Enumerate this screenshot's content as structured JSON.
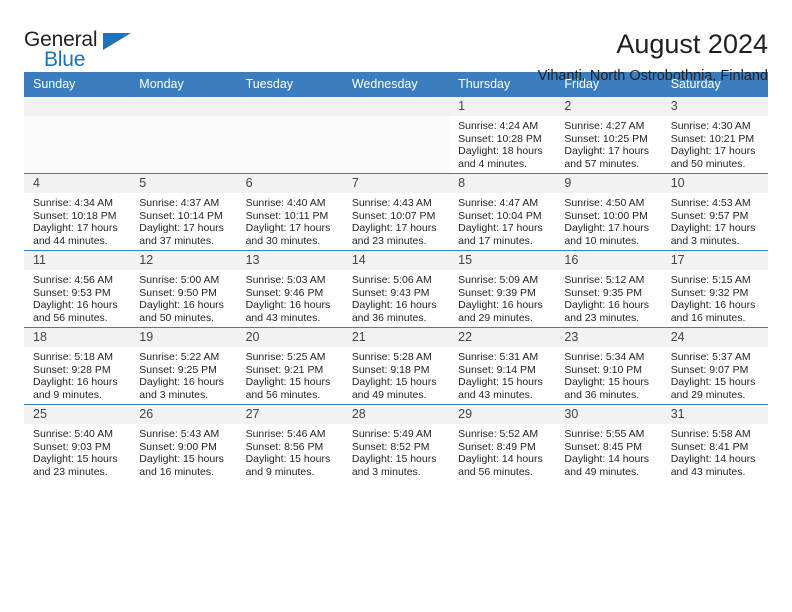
{
  "brand": {
    "name_part1": "General",
    "name_part2": "Blue",
    "flag_icon": "triangle-flag-icon",
    "accent_color": "#1f72bd"
  },
  "header": {
    "title": "August 2024",
    "subtitle": "Vihanti, North Ostrobothnia, Finland"
  },
  "calendar": {
    "header_bg": "#3a7ebf",
    "weekday_headers": [
      "Sunday",
      "Monday",
      "Tuesday",
      "Wednesday",
      "Thursday",
      "Friday",
      "Saturday"
    ],
    "weeks": [
      [
        {
          "day": "",
          "sunrise": "",
          "sunset": "",
          "daylight1": "",
          "daylight2": ""
        },
        {
          "day": "",
          "sunrise": "",
          "sunset": "",
          "daylight1": "",
          "daylight2": ""
        },
        {
          "day": "",
          "sunrise": "",
          "sunset": "",
          "daylight1": "",
          "daylight2": ""
        },
        {
          "day": "",
          "sunrise": "",
          "sunset": "",
          "daylight1": "",
          "daylight2": ""
        },
        {
          "day": "1",
          "sunrise": "Sunrise: 4:24 AM",
          "sunset": "Sunset: 10:28 PM",
          "daylight1": "Daylight: 18 hours",
          "daylight2": "and 4 minutes."
        },
        {
          "day": "2",
          "sunrise": "Sunrise: 4:27 AM",
          "sunset": "Sunset: 10:25 PM",
          "daylight1": "Daylight: 17 hours",
          "daylight2": "and 57 minutes."
        },
        {
          "day": "3",
          "sunrise": "Sunrise: 4:30 AM",
          "sunset": "Sunset: 10:21 PM",
          "daylight1": "Daylight: 17 hours",
          "daylight2": "and 50 minutes."
        }
      ],
      [
        {
          "day": "4",
          "sunrise": "Sunrise: 4:34 AM",
          "sunset": "Sunset: 10:18 PM",
          "daylight1": "Daylight: 17 hours",
          "daylight2": "and 44 minutes."
        },
        {
          "day": "5",
          "sunrise": "Sunrise: 4:37 AM",
          "sunset": "Sunset: 10:14 PM",
          "daylight1": "Daylight: 17 hours",
          "daylight2": "and 37 minutes."
        },
        {
          "day": "6",
          "sunrise": "Sunrise: 4:40 AM",
          "sunset": "Sunset: 10:11 PM",
          "daylight1": "Daylight: 17 hours",
          "daylight2": "and 30 minutes."
        },
        {
          "day": "7",
          "sunrise": "Sunrise: 4:43 AM",
          "sunset": "Sunset: 10:07 PM",
          "daylight1": "Daylight: 17 hours",
          "daylight2": "and 23 minutes."
        },
        {
          "day": "8",
          "sunrise": "Sunrise: 4:47 AM",
          "sunset": "Sunset: 10:04 PM",
          "daylight1": "Daylight: 17 hours",
          "daylight2": "and 17 minutes."
        },
        {
          "day": "9",
          "sunrise": "Sunrise: 4:50 AM",
          "sunset": "Sunset: 10:00 PM",
          "daylight1": "Daylight: 17 hours",
          "daylight2": "and 10 minutes."
        },
        {
          "day": "10",
          "sunrise": "Sunrise: 4:53 AM",
          "sunset": "Sunset: 9:57 PM",
          "daylight1": "Daylight: 17 hours",
          "daylight2": "and 3 minutes."
        }
      ],
      [
        {
          "day": "11",
          "sunrise": "Sunrise: 4:56 AM",
          "sunset": "Sunset: 9:53 PM",
          "daylight1": "Daylight: 16 hours",
          "daylight2": "and 56 minutes."
        },
        {
          "day": "12",
          "sunrise": "Sunrise: 5:00 AM",
          "sunset": "Sunset: 9:50 PM",
          "daylight1": "Daylight: 16 hours",
          "daylight2": "and 50 minutes."
        },
        {
          "day": "13",
          "sunrise": "Sunrise: 5:03 AM",
          "sunset": "Sunset: 9:46 PM",
          "daylight1": "Daylight: 16 hours",
          "daylight2": "and 43 minutes."
        },
        {
          "day": "14",
          "sunrise": "Sunrise: 5:06 AM",
          "sunset": "Sunset: 9:43 PM",
          "daylight1": "Daylight: 16 hours",
          "daylight2": "and 36 minutes."
        },
        {
          "day": "15",
          "sunrise": "Sunrise: 5:09 AM",
          "sunset": "Sunset: 9:39 PM",
          "daylight1": "Daylight: 16 hours",
          "daylight2": "and 29 minutes."
        },
        {
          "day": "16",
          "sunrise": "Sunrise: 5:12 AM",
          "sunset": "Sunset: 9:35 PM",
          "daylight1": "Daylight: 16 hours",
          "daylight2": "and 23 minutes."
        },
        {
          "day": "17",
          "sunrise": "Sunrise: 5:15 AM",
          "sunset": "Sunset: 9:32 PM",
          "daylight1": "Daylight: 16 hours",
          "daylight2": "and 16 minutes."
        }
      ],
      [
        {
          "day": "18",
          "sunrise": "Sunrise: 5:18 AM",
          "sunset": "Sunset: 9:28 PM",
          "daylight1": "Daylight: 16 hours",
          "daylight2": "and 9 minutes."
        },
        {
          "day": "19",
          "sunrise": "Sunrise: 5:22 AM",
          "sunset": "Sunset: 9:25 PM",
          "daylight1": "Daylight: 16 hours",
          "daylight2": "and 3 minutes."
        },
        {
          "day": "20",
          "sunrise": "Sunrise: 5:25 AM",
          "sunset": "Sunset: 9:21 PM",
          "daylight1": "Daylight: 15 hours",
          "daylight2": "and 56 minutes."
        },
        {
          "day": "21",
          "sunrise": "Sunrise: 5:28 AM",
          "sunset": "Sunset: 9:18 PM",
          "daylight1": "Daylight: 15 hours",
          "daylight2": "and 49 minutes."
        },
        {
          "day": "22",
          "sunrise": "Sunrise: 5:31 AM",
          "sunset": "Sunset: 9:14 PM",
          "daylight1": "Daylight: 15 hours",
          "daylight2": "and 43 minutes."
        },
        {
          "day": "23",
          "sunrise": "Sunrise: 5:34 AM",
          "sunset": "Sunset: 9:10 PM",
          "daylight1": "Daylight: 15 hours",
          "daylight2": "and 36 minutes."
        },
        {
          "day": "24",
          "sunrise": "Sunrise: 5:37 AM",
          "sunset": "Sunset: 9:07 PM",
          "daylight1": "Daylight: 15 hours",
          "daylight2": "and 29 minutes."
        }
      ],
      [
        {
          "day": "25",
          "sunrise": "Sunrise: 5:40 AM",
          "sunset": "Sunset: 9:03 PM",
          "daylight1": "Daylight: 15 hours",
          "daylight2": "and 23 minutes."
        },
        {
          "day": "26",
          "sunrise": "Sunrise: 5:43 AM",
          "sunset": "Sunset: 9:00 PM",
          "daylight1": "Daylight: 15 hours",
          "daylight2": "and 16 minutes."
        },
        {
          "day": "27",
          "sunrise": "Sunrise: 5:46 AM",
          "sunset": "Sunset: 8:56 PM",
          "daylight1": "Daylight: 15 hours",
          "daylight2": "and 9 minutes."
        },
        {
          "day": "28",
          "sunrise": "Sunrise: 5:49 AM",
          "sunset": "Sunset: 8:52 PM",
          "daylight1": "Daylight: 15 hours",
          "daylight2": "and 3 minutes."
        },
        {
          "day": "29",
          "sunrise": "Sunrise: 5:52 AM",
          "sunset": "Sunset: 8:49 PM",
          "daylight1": "Daylight: 14 hours",
          "daylight2": "and 56 minutes."
        },
        {
          "day": "30",
          "sunrise": "Sunrise: 5:55 AM",
          "sunset": "Sunset: 8:45 PM",
          "daylight1": "Daylight: 14 hours",
          "daylight2": "and 49 minutes."
        },
        {
          "day": "31",
          "sunrise": "Sunrise: 5:58 AM",
          "sunset": "Sunset: 8:41 PM",
          "daylight1": "Daylight: 14 hours",
          "daylight2": "and 43 minutes."
        }
      ]
    ]
  }
}
